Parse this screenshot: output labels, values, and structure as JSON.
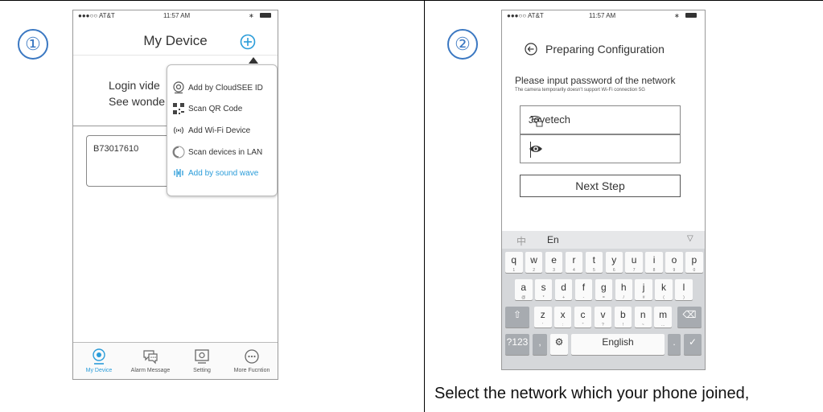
{
  "steps": [
    "①",
    "②"
  ],
  "phone1": {
    "status": {
      "carrier": "●●●○○ AT&T",
      "time": "11:57 AM"
    },
    "title": "My Device",
    "login_line1": "Login vide",
    "login_line2": "See wonde",
    "device_id": "B73017610",
    "menu": [
      {
        "label": "Add by CloudSEE  ID",
        "icon": "cloudsee-icon"
      },
      {
        "label": "Scan QR Code",
        "icon": "qr-code-icon"
      },
      {
        "label": "Add Wi-Fi Device",
        "icon": "wifi-icon"
      },
      {
        "label": "Scan devices in LAN",
        "icon": "lan-icon"
      },
      {
        "label": "Add by sound wave",
        "icon": "sound-wave-icon"
      }
    ],
    "tabs": [
      {
        "label": "My Device",
        "icon": "camera-icon"
      },
      {
        "label": "Alarm Message",
        "icon": "message-icon"
      },
      {
        "label": "Setting",
        "icon": "setting-icon"
      },
      {
        "label": "More Fucntion",
        "icon": "more-icon"
      }
    ],
    "accent": "#2a9cd9"
  },
  "phone2": {
    "status": {
      "carrier": "●●●○○ AT&T",
      "time": "11:57 AM"
    },
    "title": "Preparing  Configuration",
    "prompt": "Please input password of the network",
    "note": "The camera temporarily doesn't support Wi-Fi connection 5G",
    "ssid": "Jovetech",
    "password": "",
    "next_label": "Next Step",
    "kb": {
      "lang_cn": "中",
      "lang_en": "En",
      "row1": [
        [
          "q",
          "1"
        ],
        [
          "w",
          "2"
        ],
        [
          "e",
          "3"
        ],
        [
          "r",
          "4"
        ],
        [
          "t",
          "5"
        ],
        [
          "y",
          "6"
        ],
        [
          "u",
          "7"
        ],
        [
          "i",
          "8"
        ],
        [
          "o",
          "9"
        ],
        [
          "p",
          "0"
        ]
      ],
      "row2": [
        [
          "a",
          "@"
        ],
        [
          "s",
          "*"
        ],
        [
          "d",
          "+"
        ],
        [
          "f",
          "-"
        ],
        [
          "g",
          "="
        ],
        [
          "h",
          "/"
        ],
        [
          "j",
          "#"
        ],
        [
          "k",
          "("
        ],
        [
          "l",
          ")"
        ]
      ],
      "row3": [
        [
          "z",
          "'"
        ],
        [
          "x",
          ":"
        ],
        [
          "c",
          "\""
        ],
        [
          "v",
          "?"
        ],
        [
          "b",
          "!"
        ],
        [
          "n",
          "~"
        ],
        [
          "m",
          "…"
        ]
      ],
      "sym": "?123",
      "comma": ",",
      "space": "English",
      "period": "."
    }
  },
  "caption": "Select the network which your phone joined,"
}
